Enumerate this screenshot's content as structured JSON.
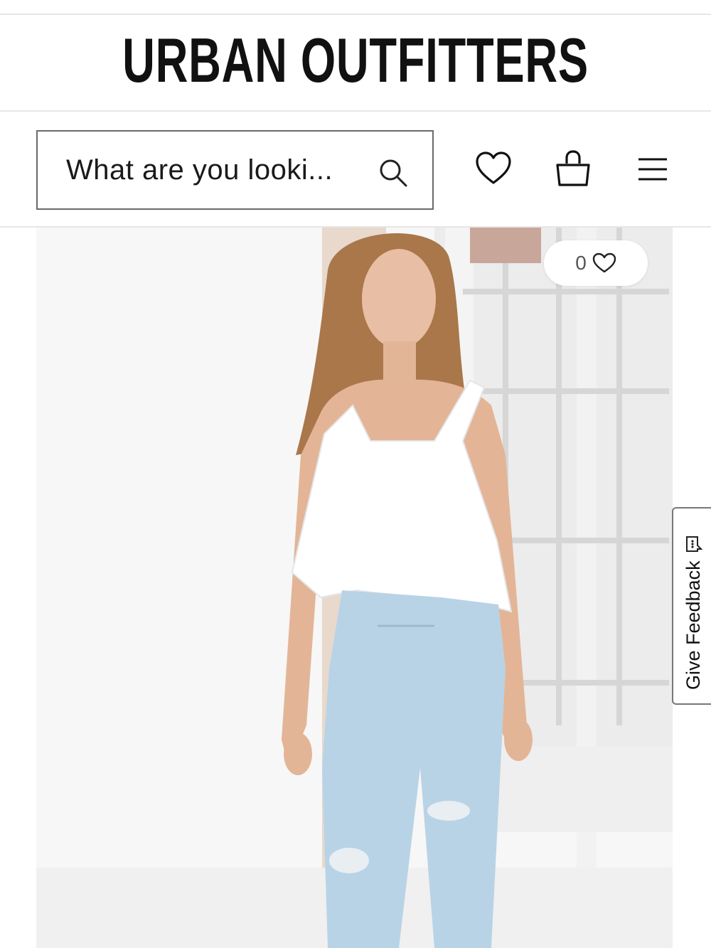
{
  "header": {
    "logo": "URBAN OUTFITTERS"
  },
  "search": {
    "placeholder": "What are you looki...",
    "icon": "search-icon"
  },
  "header_icons": [
    "heart-icon",
    "bag-icon",
    "menu-icon"
  ],
  "product": {
    "image_description": "model",
    "like_count": "0"
  },
  "feedback": {
    "label": "Give Feedback"
  },
  "colors": {
    "text": "#111111",
    "border": "#6a6a6a",
    "divider": "#e6e6e6"
  }
}
